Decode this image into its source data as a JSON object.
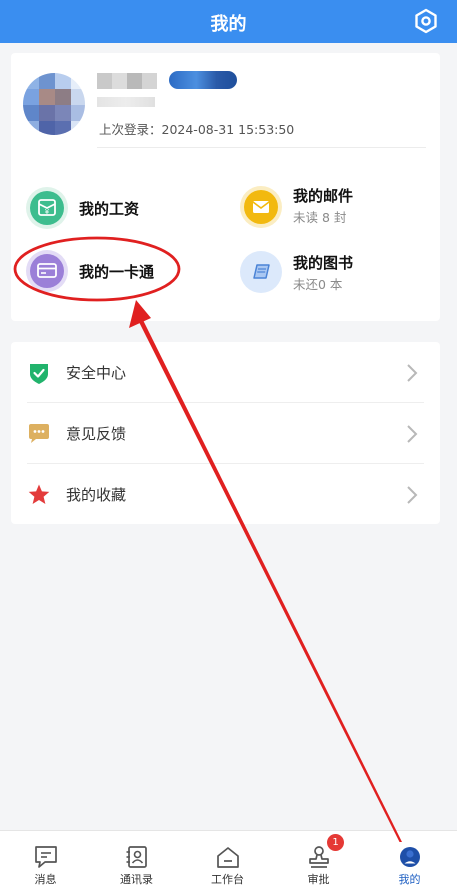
{
  "header": {
    "title": "我的"
  },
  "profile": {
    "last_login": "上次登录：2024-08-31 15:53:50"
  },
  "entries": [
    {
      "label": "我的工资",
      "sub": ""
    },
    {
      "label": "我的邮件",
      "sub": "未读 8 封"
    },
    {
      "label": "我的一卡通",
      "sub": ""
    },
    {
      "label": "我的图书",
      "sub": "未还0 本"
    }
  ],
  "menu": [
    {
      "label": "安全中心",
      "icon": "shield-icon"
    },
    {
      "label": "意见反馈",
      "icon": "feedback-icon"
    },
    {
      "label": "我的收藏",
      "icon": "star-icon"
    }
  ],
  "tabbar": {
    "tabs": [
      {
        "label": "消息"
      },
      {
        "label": "通讯录"
      },
      {
        "label": "工作台"
      },
      {
        "label": "审批",
        "badge": "1"
      },
      {
        "label": "我的"
      }
    ]
  },
  "colors": {
    "accent": "#3a8ef0",
    "annotation": "#e02020"
  }
}
